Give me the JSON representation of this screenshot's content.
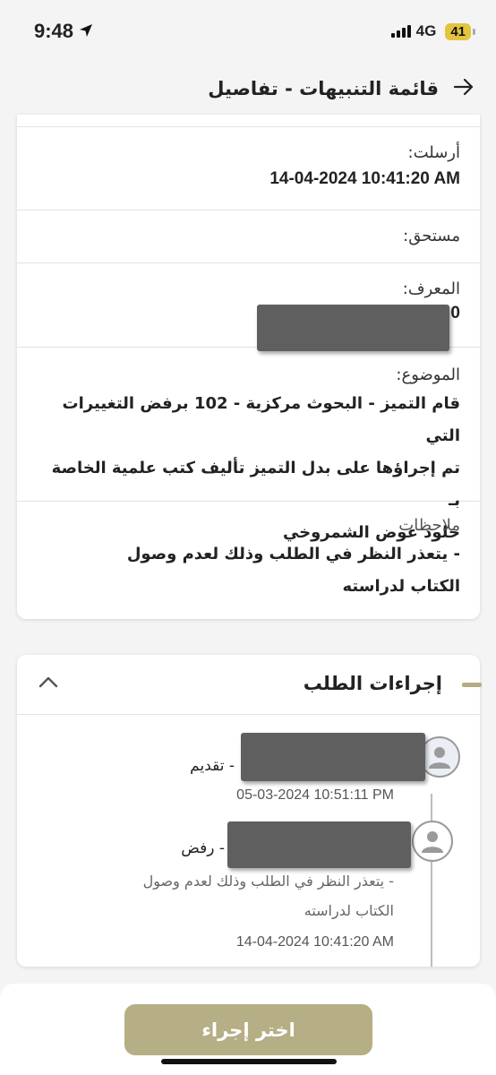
{
  "status_bar": {
    "time": "9:48",
    "network": "4G",
    "battery": "41"
  },
  "header": {
    "title": "قائمة التنبيهات - تفاصيل",
    "back_icon": "arrow-right-icon"
  },
  "details": {
    "sent_label": "أرسلت:",
    "sent_value": "14-04-2024 10:41:20 AM",
    "due_label": "مستحق:",
    "due_value": "",
    "id_label": "المعرف:",
    "id_value_visible": "0",
    "subject_label": "الموضوع:",
    "subject_lines": [
      "قام التميز - البحوث مركزية - 102 برفض التغييرات التي",
      "تم إجراؤها على بدل التميز  تأليف كتب علمية الخاصة بـ",
      "خلود عوض الشمروخي"
    ],
    "notes_label": "ملاحظات",
    "notes_lines": [
      "- يتعذر النظر في الطلب وذلك لعدم وصول",
      "الكتاب لدراسته"
    ]
  },
  "actions": {
    "title": "إجراءات الطلب",
    "items": [
      {
        "action": "- تقديم",
        "date": "05-03-2024 10:51:11 PM",
        "note_lines": []
      },
      {
        "action": "- رفض",
        "date": "14-04-2024 10:41:20 AM",
        "note_lines": [
          "- يتعذر النظر في الطلب وذلك لعدم وصول",
          "الكتاب لدراسته"
        ]
      }
    ]
  },
  "button": {
    "label": "اختر إجراء"
  },
  "colors": {
    "accent": "#b6ae84",
    "battery": "#e2c53d"
  }
}
